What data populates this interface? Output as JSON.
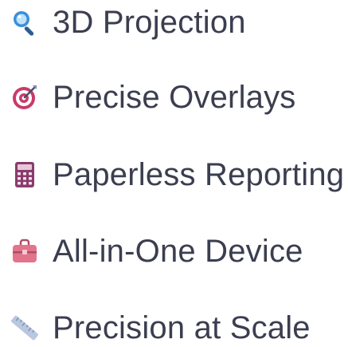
{
  "features": [
    {
      "icon": "magnifying-glass-icon",
      "label": "3D Projection"
    },
    {
      "icon": "target-icon",
      "label": "Precise Overlays"
    },
    {
      "icon": "calculator-icon",
      "label": "Paperless Reporting"
    },
    {
      "icon": "briefcase-icon",
      "label": "All-in-One Device"
    },
    {
      "icon": "ruler-icon",
      "label": "Precision at Scale"
    }
  ],
  "colors": {
    "text": "#3b3e4f",
    "magnifier": "#3a8fd8",
    "target": "#c93a6a",
    "calculator": "#8a3b6c",
    "briefcase": "#e2748c",
    "ruler": "#b9c7df"
  }
}
